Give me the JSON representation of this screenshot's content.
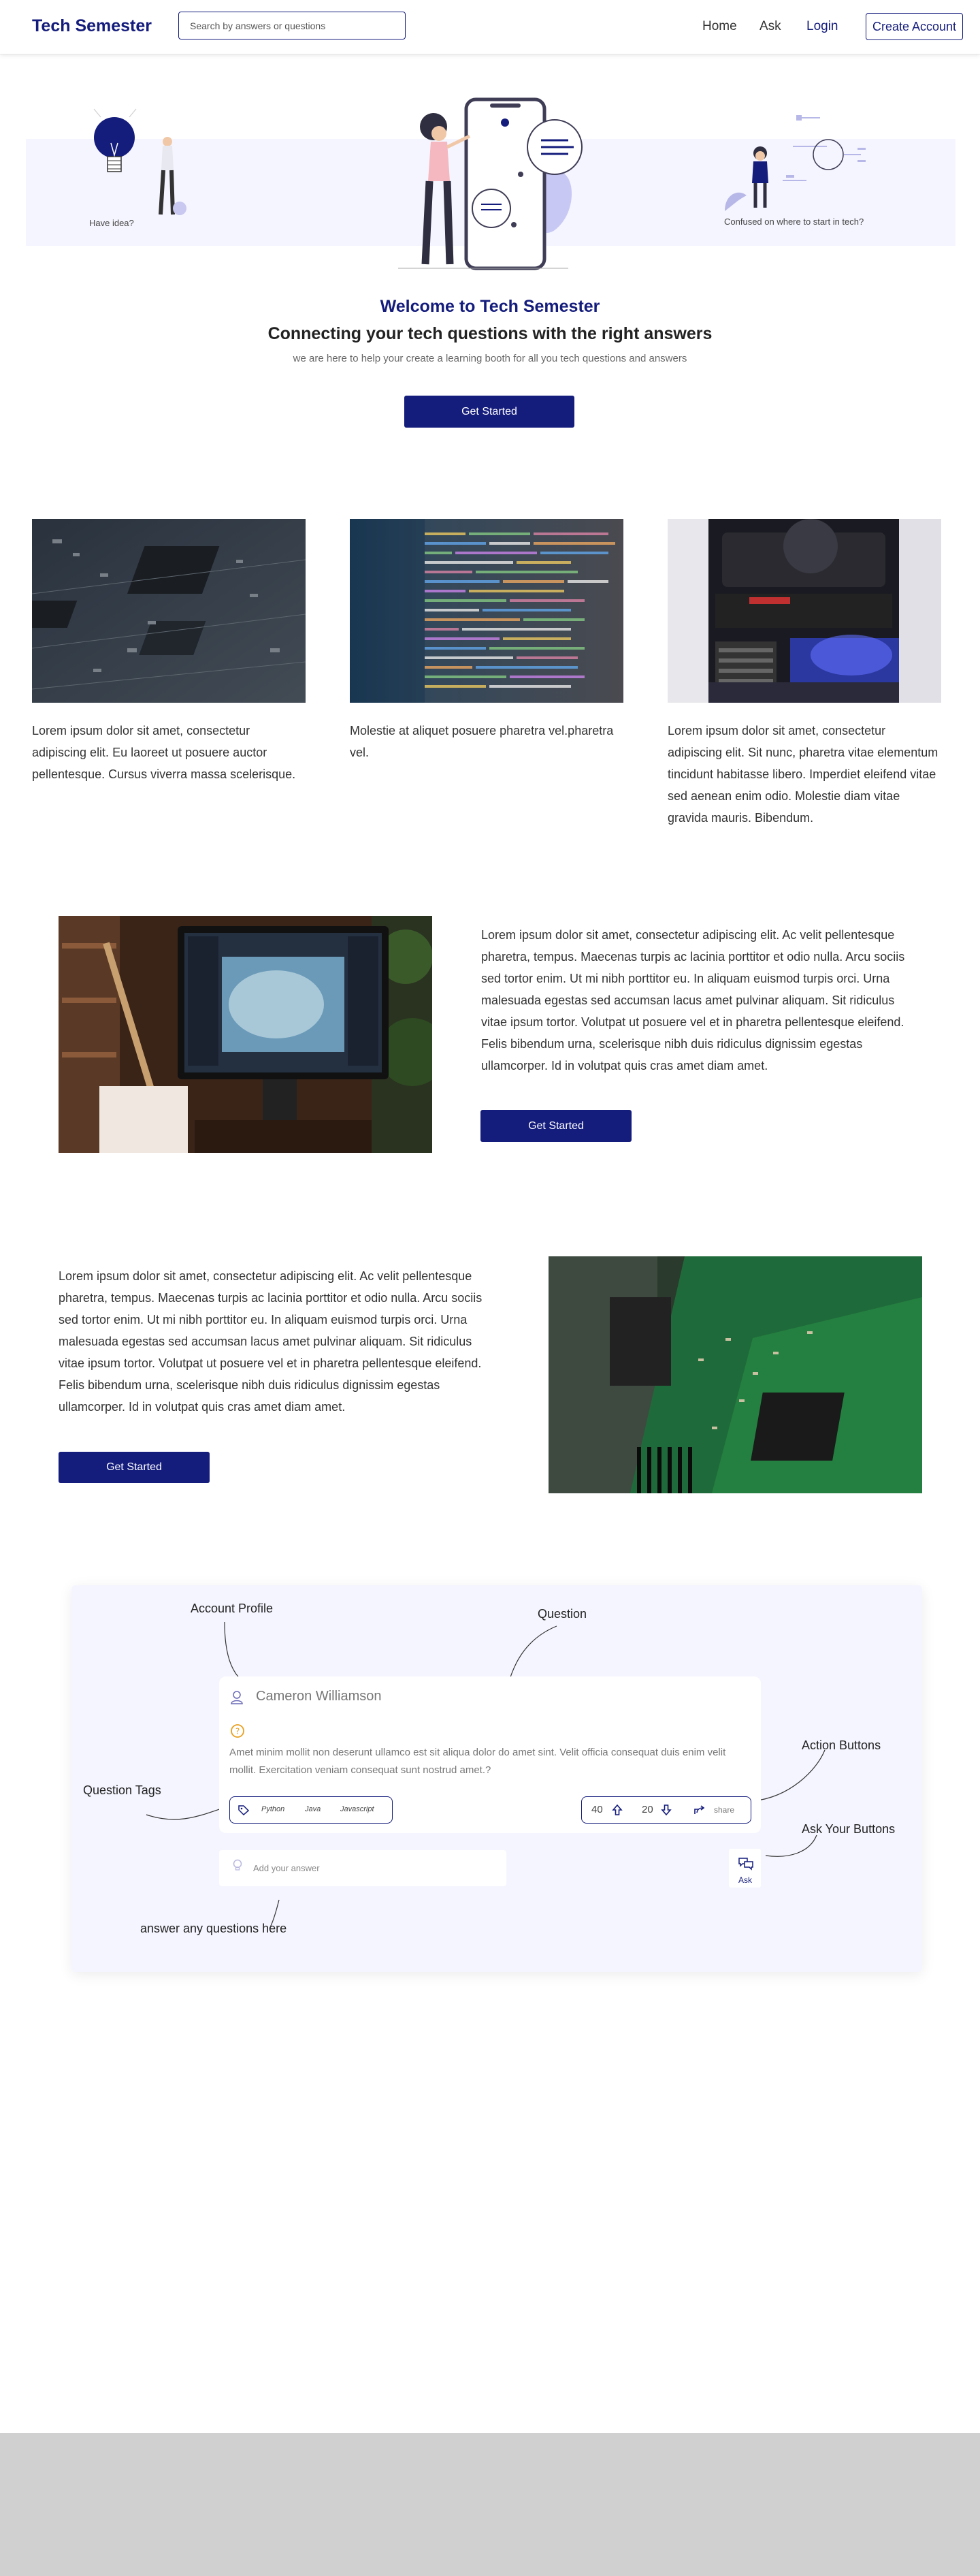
{
  "nav": {
    "brand": "Tech Semester",
    "search_placeholder": "Search by answers or questions",
    "links": {
      "home": "Home",
      "ask": "Ask",
      "login": "Login"
    },
    "create_account": "Create Account"
  },
  "hero": {
    "caption_left": "Have idea?",
    "caption_right": "Confused on where to start in tech?",
    "title": "Welcome to Tech Semester",
    "subtitle": "Connecting your tech questions with the right answers",
    "text": "we are here to help your create a learning booth for all you tech questions and answers",
    "cta": "Get Started"
  },
  "cards": [
    {
      "image": "circuit-board-photo",
      "text": "Lorem ipsum dolor sit amet, consectetur adipiscing elit. Eu laoreet ut posuere auctor pellentesque. Cursus viverra massa scelerisque."
    },
    {
      "image": "code-screen-photo",
      "text": "Molestie at aliquet posuere pharetra vel.pharetra vel."
    },
    {
      "image": "pc-internals-photo",
      "text": "Lorem ipsum dolor sit amet, consectetur adipiscing elit. Sit nunc, pharetra vitae elementum tincidunt habitasse libero. Imperdiet eleifend vitae sed aenean enim odio. Molestie diam vitae gravida mauris. Bibendum."
    }
  ],
  "feature1": {
    "image": "monitor-on-desk-photo",
    "text": "Lorem ipsum dolor sit amet, consectetur adipiscing elit. Ac velit pellentesque pharetra, tempus. Maecenas turpis ac lacinia porttitor et odio nulla. Arcu sociis sed tortor enim. Ut mi nibh porttitor eu. In aliquam euismod turpis orci. Urna malesuada egestas sed accumsan lacus amet pulvinar aliquam. Sit ridiculus vitae ipsum tortor. Volutpat ut posuere vel et in pharetra pellentesque eleifend. Felis bibendum urna, scelerisque nibh duis ridiculus dignissim egestas ullamcorper. Id in volutpat quis cras amet diam amet.",
    "cta": "Get Started"
  },
  "feature2": {
    "image": "green-pcb-photo",
    "text": "Lorem ipsum dolor sit amet, consectetur adipiscing elit. Ac velit pellentesque pharetra, tempus. Maecenas turpis ac lacinia porttitor et odio nulla. Arcu sociis sed tortor enim. Ut mi nibh porttitor eu. In aliquam euismod turpis orci. Urna malesuada egestas sed accumsan lacus amet pulvinar aliquam. Sit ridiculus vitae ipsum tortor. Volutpat ut posuere vel et in pharetra pellentesque eleifend. Felis bibendum urna, scelerisque nibh duis ridiculus dignissim egestas ullamcorper. Id in volutpat quis cras amet diam amet.",
    "cta": "Get Started"
  },
  "demo": {
    "annotations": {
      "account_profile": "Account Profile",
      "question": "Question",
      "action_buttons": "Action Buttons",
      "question_tags": "Question Tags",
      "ask_your_buttons": "Ask Your Buttons",
      "answer_here": "answer any questions here"
    },
    "question_card": {
      "user_name": "Cameron Williamson",
      "body": "Amet minim mollit non deserunt ullamco est sit aliqua dolor do amet sint. Velit officia consequat duis enim velit mollit. Exercitation veniam consequat sunt nostrud amet.?",
      "tags": [
        "Python",
        "Java",
        "Javascript"
      ],
      "upvotes": "40",
      "downvotes": "20",
      "share_label": "share"
    },
    "answer_placeholder": "Add your answer",
    "ask_label": "Ask"
  },
  "colors": {
    "primary": "#141c7c",
    "hero_band": "#f5f5ff",
    "footer": "#d0d0d0"
  }
}
